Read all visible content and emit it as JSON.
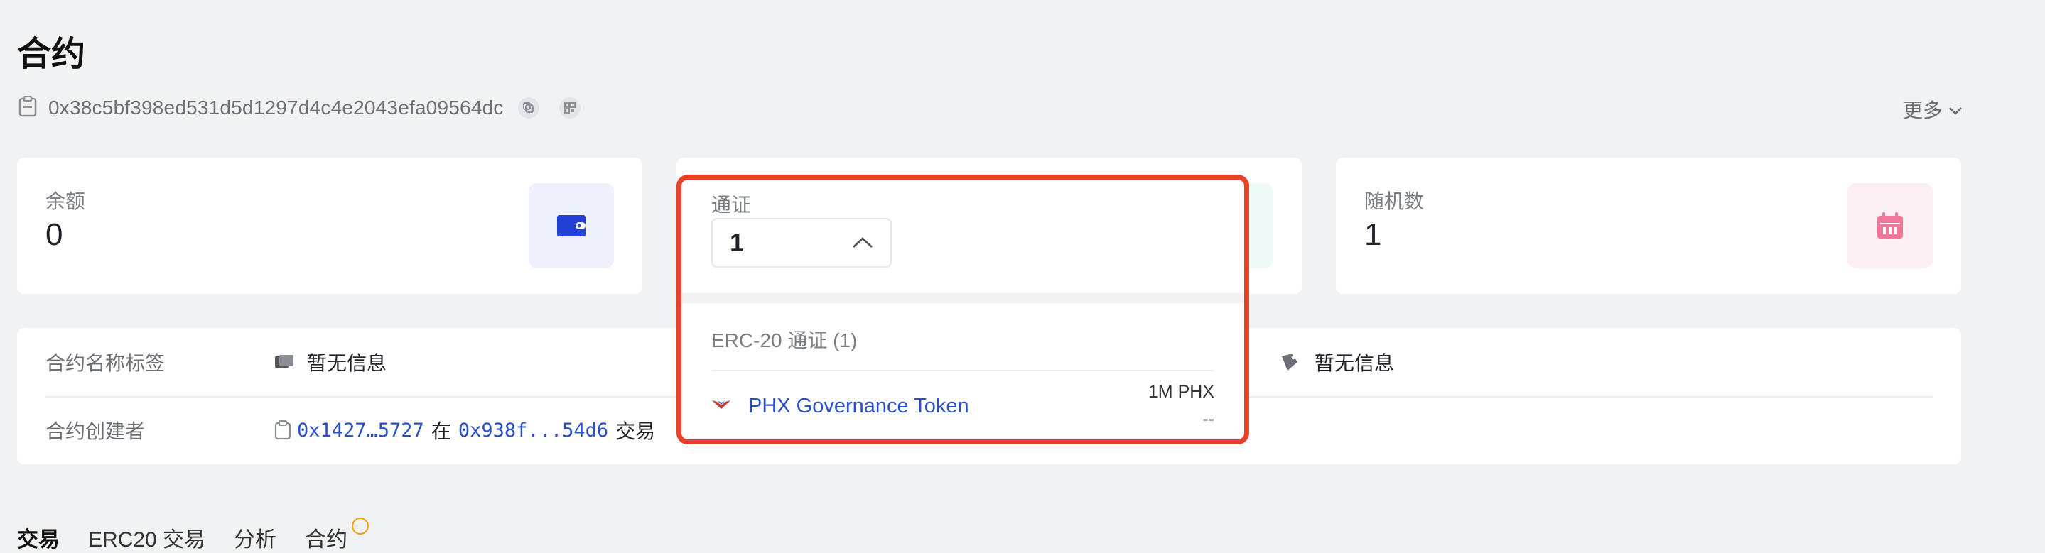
{
  "page": {
    "title": "合约",
    "address": "0x38c5bf398ed531d5d1297d4c4e2043efa09564dc",
    "more_label": "更多"
  },
  "cards": {
    "balance": {
      "label": "余额",
      "value": "0"
    },
    "token": {
      "label": "通证",
      "value": "1"
    },
    "nonce": {
      "label": "随机数",
      "value": "1"
    }
  },
  "info": {
    "name_tag_label": "合约名称标签",
    "name_tag_value": "暂无信息",
    "right_value": "暂无信息",
    "creator_label": "合约创建者",
    "creator_address": "0x1427…5727",
    "creator_in": "在",
    "creator_tx": "0x938f...54d6",
    "creator_tx_suffix": "交易"
  },
  "dropdown": {
    "selected": "1",
    "group_label": "ERC-20 通证 (1)",
    "items": [
      {
        "name": "PHX Governance Token",
        "amount": "1M PHX",
        "value": "--"
      }
    ]
  },
  "tabs": [
    "交易",
    "ERC20 交易",
    "分析",
    "合约"
  ],
  "colors": {
    "highlight": "#e8402b",
    "link": "#2a50c9",
    "wallet_icon": "#2340d6",
    "token_icon": "#54d3c2",
    "calendar_icon": "#f2759a"
  }
}
